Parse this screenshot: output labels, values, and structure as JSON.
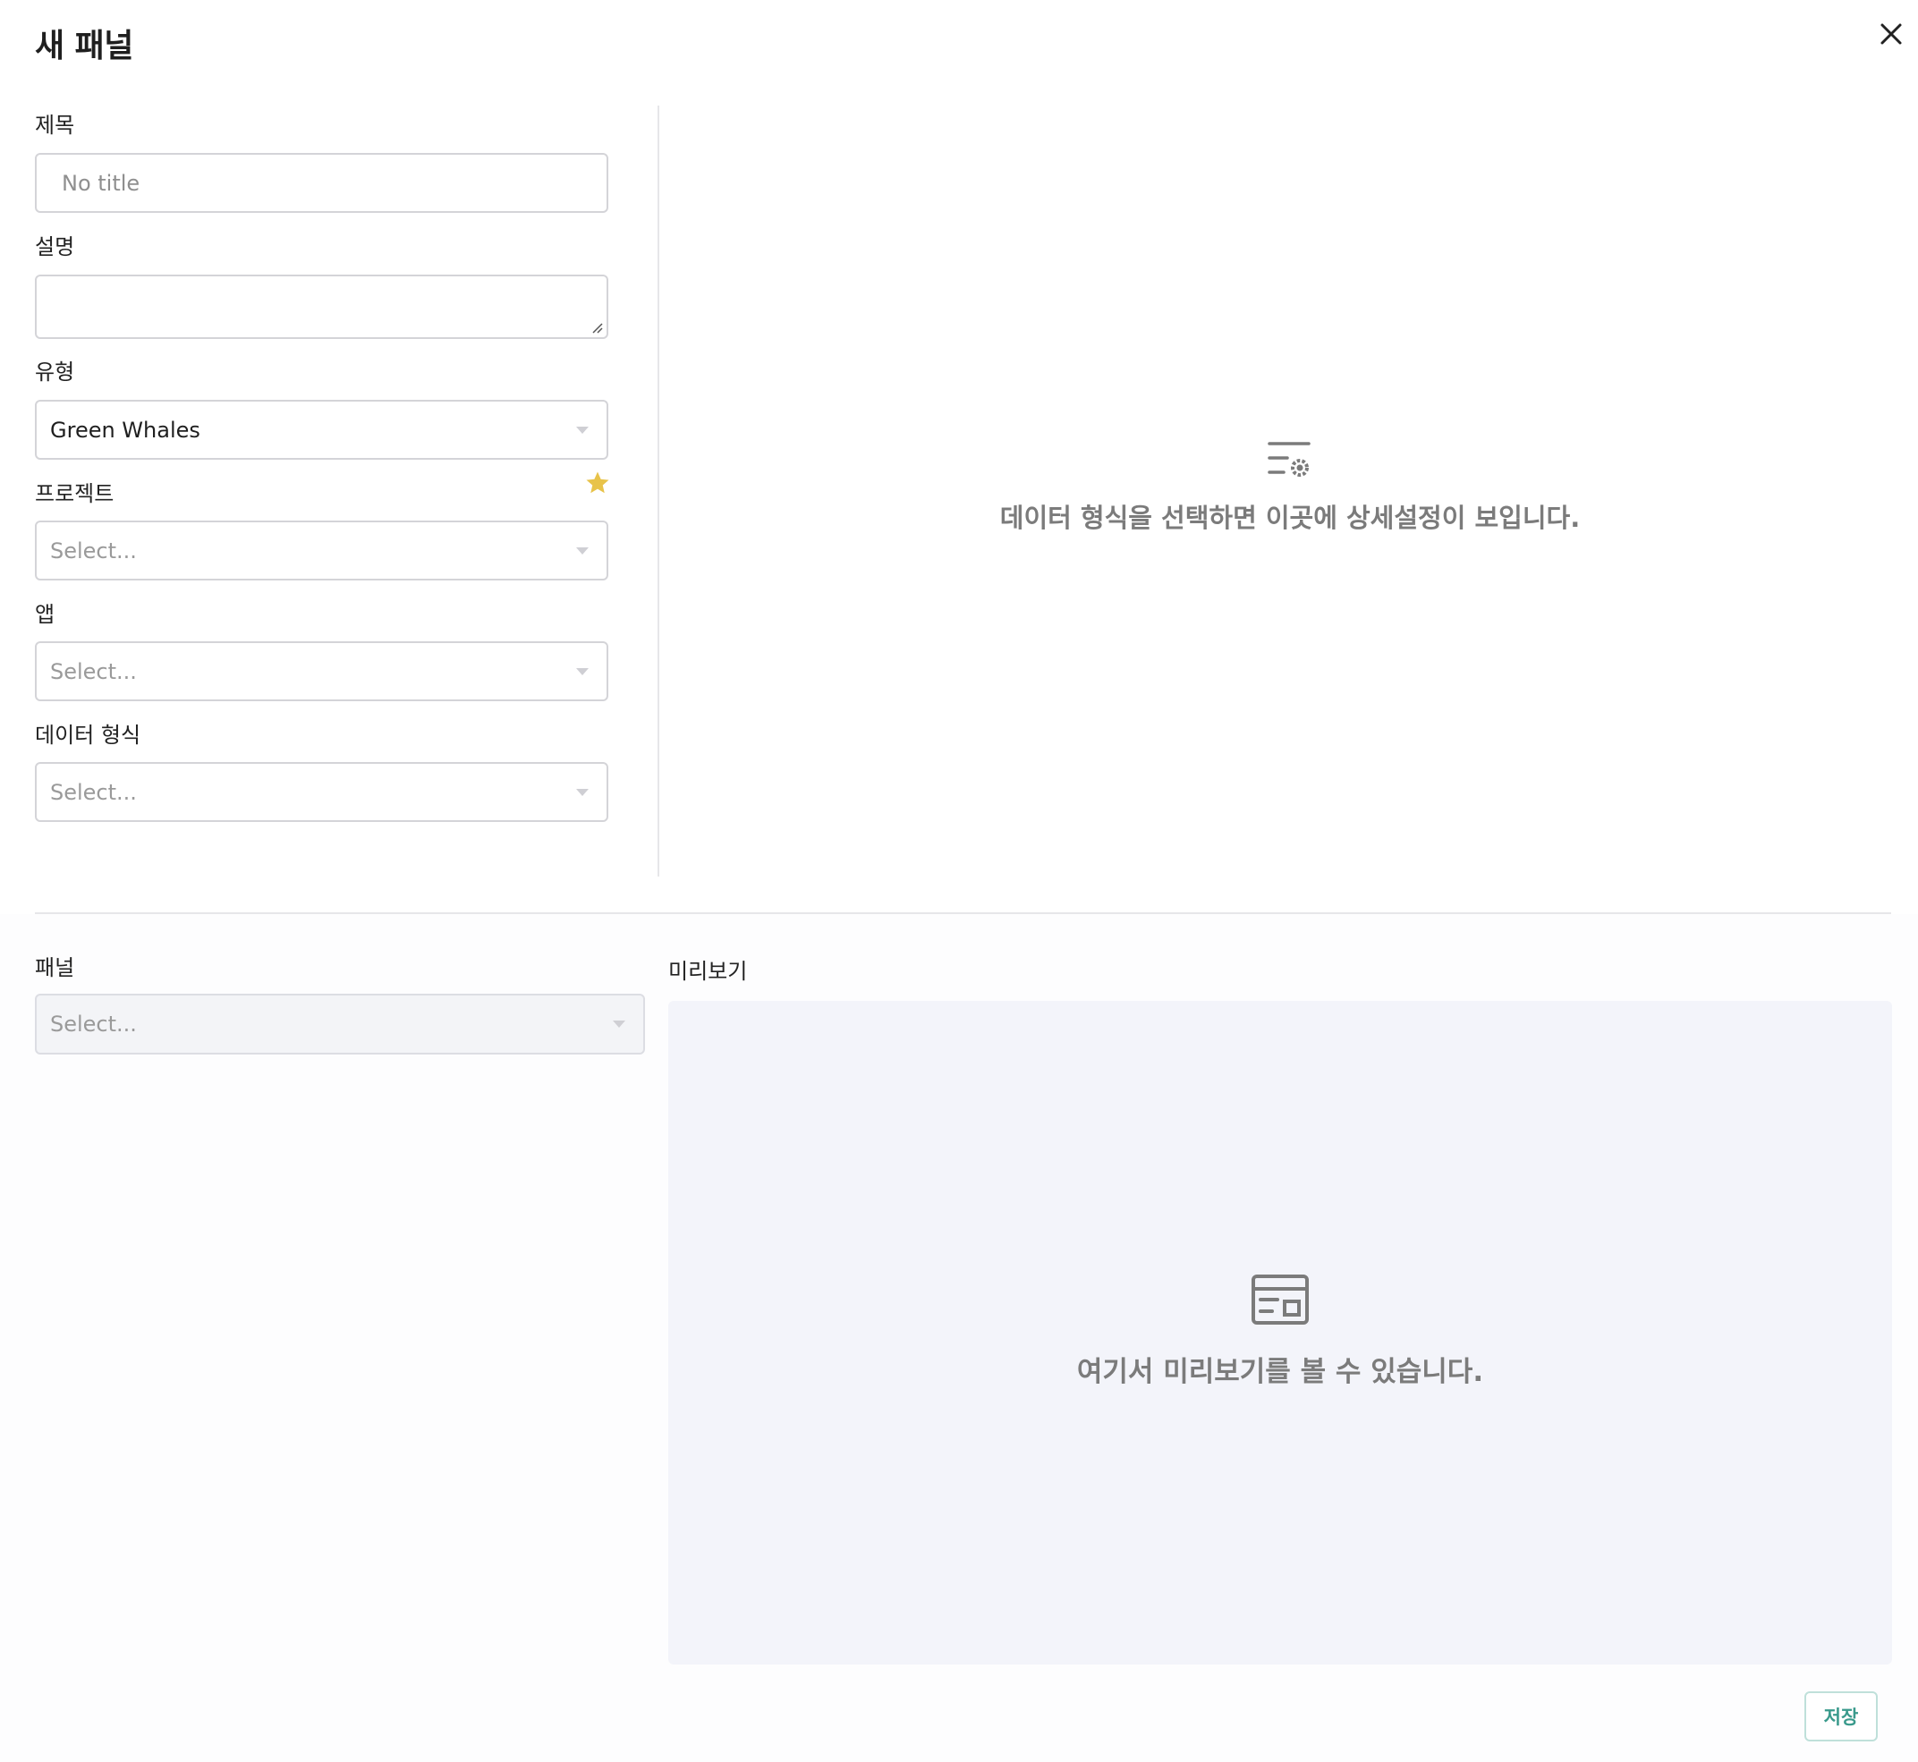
{
  "modal": {
    "title": "새 패널",
    "close_icon": "close-icon"
  },
  "form": {
    "title_label": "제목",
    "title_placeholder": "No title",
    "title_value": "",
    "description_label": "설명",
    "description_value": "",
    "type_label": "유형",
    "type_value": "Green Whales",
    "project_label": "프로젝트",
    "project_placeholder": "Select...",
    "project_star_icon": "star-icon",
    "project_star_color": "#e8c34a",
    "app_label": "앱",
    "app_placeholder": "Select...",
    "data_format_label": "데이터 형식",
    "data_format_placeholder": "Select..."
  },
  "settings_empty": {
    "icon": "list-settings-icon",
    "message": "데이터 형식을 선택하면 이곳에 상세설정이 보입니다."
  },
  "panel": {
    "label": "패널",
    "placeholder": "Select..."
  },
  "preview": {
    "label": "미리보기",
    "icon": "layout-preview-icon",
    "message": "여기서 미리보기를 볼 수 있습니다."
  },
  "actions": {
    "save_label": "저장",
    "accent_color": "#3a9a8c"
  }
}
